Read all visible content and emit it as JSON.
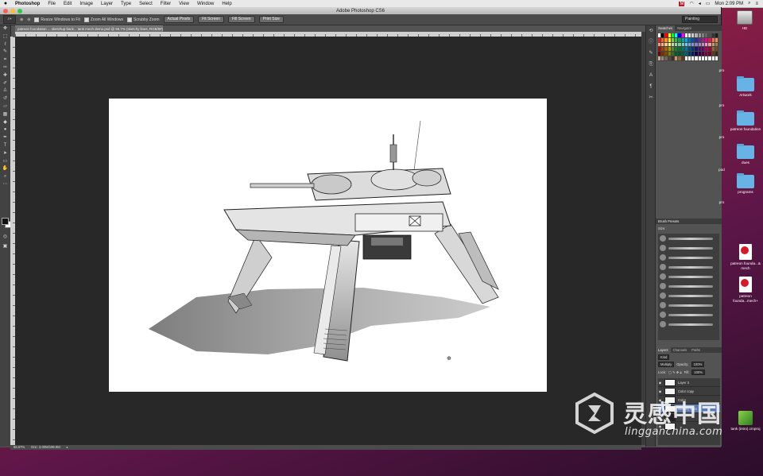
{
  "menubar": {
    "app": "Photoshop",
    "items": [
      "File",
      "Edit",
      "Image",
      "Layer",
      "Type",
      "Select",
      "Filter",
      "View",
      "Window",
      "Help"
    ],
    "clock": "Mon 2:09 PM"
  },
  "window": {
    "title": "Adobe Photoshop CS6"
  },
  "options": {
    "resize_windows": "Resize Windows to Fit",
    "zoom_all": "Zoom All Windows",
    "scrubby_zoom": "Scrubby Zoom",
    "actual_pixels": "Actual Pixels",
    "fit_screen": "Fit Screen",
    "fill_screen": "Fill Screen",
    "print_size": "Print Size",
    "workspace": "Painting"
  },
  "document": {
    "tab": "patreon foundation ... sketchup back... tank mech demo.psd @ 66.7% (sketchy lines, RGB/8#) *",
    "zoom": "66.67%",
    "doc_size": "Doc: 3.00M/196.9M"
  },
  "panels": {
    "swatches_tab": "Swatches",
    "navigator_tab": "Navigator",
    "brushes_tab": "Brush Presets",
    "brush_size_label": "Size:",
    "layers_tab": "Layers",
    "channels_tab": "Channels",
    "paths_tab": "Paths",
    "kind_label": "Kind",
    "blend_mode": "Multiply",
    "opacity_label": "Opacity:",
    "opacity_value": "100%",
    "lock_label": "Lock:",
    "fill_label": "Fill:",
    "fill_value": "100%",
    "layers": [
      {
        "name": "Layer 3",
        "selected": false
      },
      {
        "name": "Color copy",
        "selected": false
      },
      {
        "name": "Color",
        "selected": false
      },
      {
        "name": "sketchy lines",
        "selected": true
      },
      {
        "name": "",
        "selected": false
      },
      {
        "name": "",
        "selected": false
      }
    ]
  },
  "desktop": {
    "hd": "HD",
    "folders": [
      "Artwork",
      "patreon foundation",
      "dues",
      "programs"
    ],
    "files": [
      "patreon founda...& mech",
      "patreon founda...mech+"
    ],
    "app_file": "tank (intro).cmproj",
    "stray_labels": [
      "pro",
      "pro",
      "pro",
      "pod",
      "pro"
    ]
  },
  "watermark": {
    "cn": "灵感中国",
    "url": "lingganchina.com"
  },
  "colors": {
    "ps_bg": "#535353",
    "canvas_bg": "#282828",
    "desktop_accent": "#8a1e44"
  }
}
